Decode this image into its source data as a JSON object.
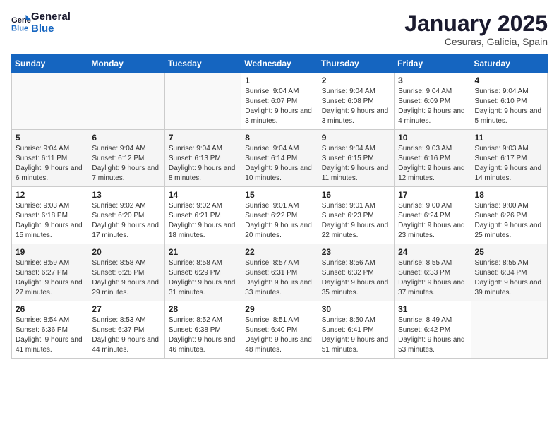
{
  "logo": {
    "line1": "General",
    "line2": "Blue"
  },
  "title": "January 2025",
  "location": "Cesuras, Galicia, Spain",
  "weekdays": [
    "Sunday",
    "Monday",
    "Tuesday",
    "Wednesday",
    "Thursday",
    "Friday",
    "Saturday"
  ],
  "weeks": [
    [
      {
        "day": "",
        "info": ""
      },
      {
        "day": "",
        "info": ""
      },
      {
        "day": "",
        "info": ""
      },
      {
        "day": "1",
        "info": "Sunrise: 9:04 AM\nSunset: 6:07 PM\nDaylight: 9 hours and 3 minutes."
      },
      {
        "day": "2",
        "info": "Sunrise: 9:04 AM\nSunset: 6:08 PM\nDaylight: 9 hours and 3 minutes."
      },
      {
        "day": "3",
        "info": "Sunrise: 9:04 AM\nSunset: 6:09 PM\nDaylight: 9 hours and 4 minutes."
      },
      {
        "day": "4",
        "info": "Sunrise: 9:04 AM\nSunset: 6:10 PM\nDaylight: 9 hours and 5 minutes."
      }
    ],
    [
      {
        "day": "5",
        "info": "Sunrise: 9:04 AM\nSunset: 6:11 PM\nDaylight: 9 hours and 6 minutes."
      },
      {
        "day": "6",
        "info": "Sunrise: 9:04 AM\nSunset: 6:12 PM\nDaylight: 9 hours and 7 minutes."
      },
      {
        "day": "7",
        "info": "Sunrise: 9:04 AM\nSunset: 6:13 PM\nDaylight: 9 hours and 8 minutes."
      },
      {
        "day": "8",
        "info": "Sunrise: 9:04 AM\nSunset: 6:14 PM\nDaylight: 9 hours and 10 minutes."
      },
      {
        "day": "9",
        "info": "Sunrise: 9:04 AM\nSunset: 6:15 PM\nDaylight: 9 hours and 11 minutes."
      },
      {
        "day": "10",
        "info": "Sunrise: 9:03 AM\nSunset: 6:16 PM\nDaylight: 9 hours and 12 minutes."
      },
      {
        "day": "11",
        "info": "Sunrise: 9:03 AM\nSunset: 6:17 PM\nDaylight: 9 hours and 14 minutes."
      }
    ],
    [
      {
        "day": "12",
        "info": "Sunrise: 9:03 AM\nSunset: 6:18 PM\nDaylight: 9 hours and 15 minutes."
      },
      {
        "day": "13",
        "info": "Sunrise: 9:02 AM\nSunset: 6:20 PM\nDaylight: 9 hours and 17 minutes."
      },
      {
        "day": "14",
        "info": "Sunrise: 9:02 AM\nSunset: 6:21 PM\nDaylight: 9 hours and 18 minutes."
      },
      {
        "day": "15",
        "info": "Sunrise: 9:01 AM\nSunset: 6:22 PM\nDaylight: 9 hours and 20 minutes."
      },
      {
        "day": "16",
        "info": "Sunrise: 9:01 AM\nSunset: 6:23 PM\nDaylight: 9 hours and 22 minutes."
      },
      {
        "day": "17",
        "info": "Sunrise: 9:00 AM\nSunset: 6:24 PM\nDaylight: 9 hours and 23 minutes."
      },
      {
        "day": "18",
        "info": "Sunrise: 9:00 AM\nSunset: 6:26 PM\nDaylight: 9 hours and 25 minutes."
      }
    ],
    [
      {
        "day": "19",
        "info": "Sunrise: 8:59 AM\nSunset: 6:27 PM\nDaylight: 9 hours and 27 minutes."
      },
      {
        "day": "20",
        "info": "Sunrise: 8:58 AM\nSunset: 6:28 PM\nDaylight: 9 hours and 29 minutes."
      },
      {
        "day": "21",
        "info": "Sunrise: 8:58 AM\nSunset: 6:29 PM\nDaylight: 9 hours and 31 minutes."
      },
      {
        "day": "22",
        "info": "Sunrise: 8:57 AM\nSunset: 6:31 PM\nDaylight: 9 hours and 33 minutes."
      },
      {
        "day": "23",
        "info": "Sunrise: 8:56 AM\nSunset: 6:32 PM\nDaylight: 9 hours and 35 minutes."
      },
      {
        "day": "24",
        "info": "Sunrise: 8:55 AM\nSunset: 6:33 PM\nDaylight: 9 hours and 37 minutes."
      },
      {
        "day": "25",
        "info": "Sunrise: 8:55 AM\nSunset: 6:34 PM\nDaylight: 9 hours and 39 minutes."
      }
    ],
    [
      {
        "day": "26",
        "info": "Sunrise: 8:54 AM\nSunset: 6:36 PM\nDaylight: 9 hours and 41 minutes."
      },
      {
        "day": "27",
        "info": "Sunrise: 8:53 AM\nSunset: 6:37 PM\nDaylight: 9 hours and 44 minutes."
      },
      {
        "day": "28",
        "info": "Sunrise: 8:52 AM\nSunset: 6:38 PM\nDaylight: 9 hours and 46 minutes."
      },
      {
        "day": "29",
        "info": "Sunrise: 8:51 AM\nSunset: 6:40 PM\nDaylight: 9 hours and 48 minutes."
      },
      {
        "day": "30",
        "info": "Sunrise: 8:50 AM\nSunset: 6:41 PM\nDaylight: 9 hours and 51 minutes."
      },
      {
        "day": "31",
        "info": "Sunrise: 8:49 AM\nSunset: 6:42 PM\nDaylight: 9 hours and 53 minutes."
      },
      {
        "day": "",
        "info": ""
      }
    ]
  ]
}
